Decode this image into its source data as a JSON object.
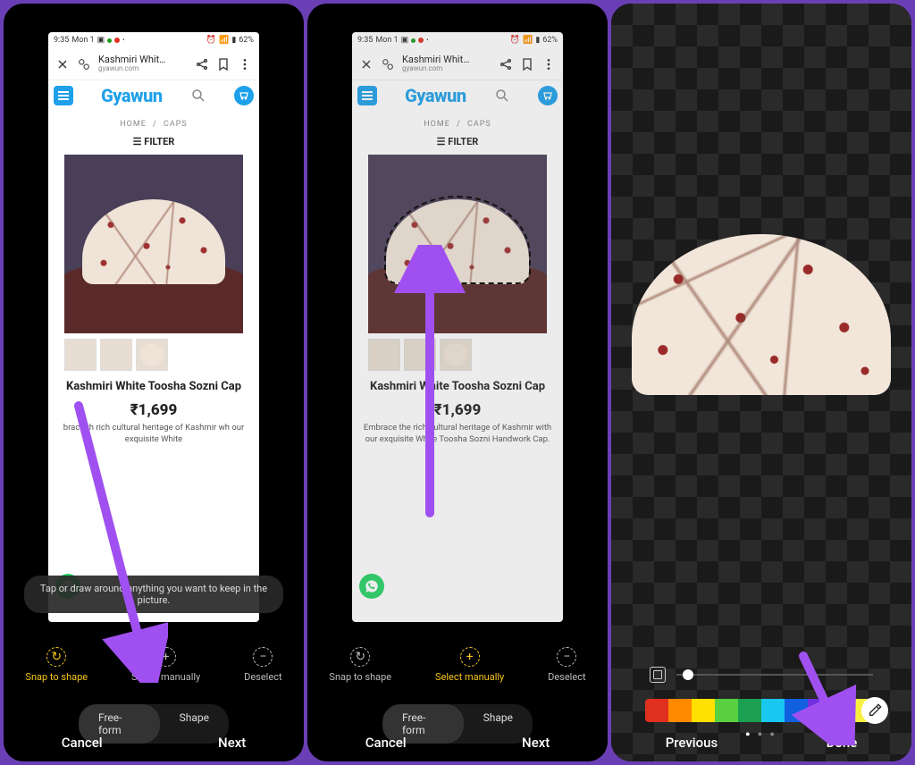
{
  "status": {
    "time": "9:35",
    "day": "Mon 1",
    "battery": "62%"
  },
  "browser": {
    "page_title": "Kashmiri Whit…",
    "domain": "gyawun.com"
  },
  "site": {
    "brand": "Gyawun",
    "crumb_home": "HOME",
    "crumb_sep": "/",
    "crumb_cat": "CAPS",
    "filter": "FILTER"
  },
  "product": {
    "name": "Kashmiri White Toosha Sozni Cap",
    "price": "₹1,699",
    "desc_full": "Embrace the rich cultural heritage of Kashmir with our exquisite White Toosha Sozni Handwork Cap.",
    "desc_cut_prefix": "brace th",
    "desc_cut_mid": " rich cultural heritage of Kashmir w",
    "desc_cut_suffix": "h our exquisite White"
  },
  "editor": {
    "tooltip": "Tap or draw around anything you want to keep in the picture.",
    "tools": {
      "snap": "Snap to shape",
      "select": "Select manually",
      "deselect": "Deselect"
    },
    "shape_freeform": "Free-form",
    "shape_shape": "Shape",
    "cancel": "Cancel",
    "next": "Next",
    "previous": "Previous",
    "done": "Done"
  },
  "palette": [
    "#e03020",
    "#ff8a00",
    "#ffe000",
    "#58d040",
    "#1aa050",
    "#18c8f0",
    "#1060e0",
    "#7030e0",
    "#202020",
    "#f8f040"
  ]
}
